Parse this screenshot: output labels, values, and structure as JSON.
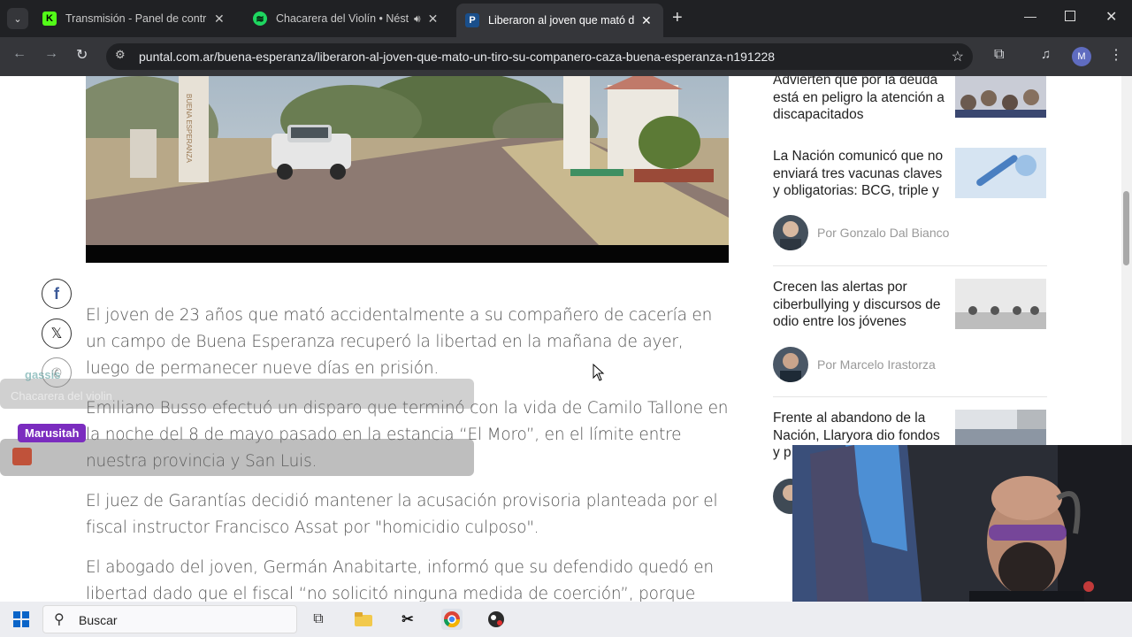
{
  "browser": {
    "tabs": [
      {
        "title": "Transmisión - Panel de control",
        "icon": "kick-icon"
      },
      {
        "title": "Chacarera del Violín • Néstor",
        "icon": "spotify-icon"
      },
      {
        "title": "Liberaron al joven que mató de un tiro",
        "icon": "puntal-icon",
        "active": true
      }
    ],
    "url": "puntal.com.ar/buena-esperanza/liberaron-al-joven-que-mato-un-tiro-su-companero-caza-buena-esperanza-n191228",
    "new_tab_label": "+",
    "profile_initial": "M"
  },
  "article": {
    "paragraphs": [
      "El joven de 23 años que mató accidentalmente a su compañero de cacería en un campo de Buena Esperanza recuperó la libertad en la mañana de ayer, luego de permanecer nueve días en prisión.",
      "Emiliano Busso efectuó un disparo que terminó con la vida de Camilo Tallone en la noche del 8 de mayo pasado en la estancia “El Moro”, en el límite entre nuestra provincia y San Luis.",
      "El juez de Garantías decidió mantener la acusación provisoria planteada por el fiscal instructor Francisco Assat por \"homicidio culposo\".",
      "El abogado del joven, Germán Anabitarte, informó que su defendido quedó en libertad dado que el fiscal “no solicitó ninguna medida de coerción”, porque"
    ],
    "image_sign": "BUENA ESPERANZA"
  },
  "sidebar": {
    "news": [
      {
        "headline": "Advierten que por la deuda está en peligro la atención a discapacitados"
      },
      {
        "headline": "La Nación comunicó que no enviará tres vacunas claves y obligatorias: BCG, triple y"
      },
      {
        "headline": "Crecen las alertas por ciberbullying y discursos de odio entre los jóvenes"
      },
      {
        "headline": "Frente al abandono de la Nación, Llaryora dio fondos y p"
      }
    ],
    "authors": [
      {
        "name": "Por Gonzalo Dal Bianco"
      },
      {
        "name": "Por Marcelo Irastorza"
      }
    ]
  },
  "stream_overlay": {
    "chat": [
      {
        "user": "gassis",
        "text": "Chacarera del violin"
      },
      {
        "user": "Marusitah",
        "text": ""
      }
    ]
  },
  "taskbar": {
    "search_placeholder": "Buscar"
  },
  "colors": {
    "accent_chrome_dark": "#202124",
    "kick_green": "#53fc18",
    "spotify_green": "#1ed760",
    "marusitah_badge": "#7b2cbf"
  }
}
